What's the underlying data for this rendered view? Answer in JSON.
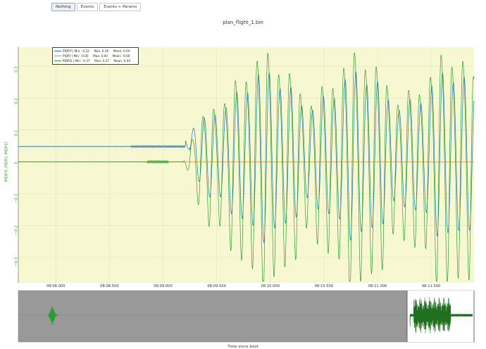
{
  "toolbar": {
    "buttons": [
      {
        "label": "Nothing",
        "active": true
      },
      {
        "label": "Events",
        "active": false
      },
      {
        "label": "Events + Params",
        "active": false
      }
    ]
  },
  "chart_data": {
    "type": "line",
    "title": "plan_flight_1.bin",
    "ylabel": "PIDP.P, PIDP.I, PIDP.D",
    "xlabel": "Time since boot",
    "background": "#f7f7d2",
    "navigator_background": "#999999",
    "x_ticks": [
      "08:08.000",
      "08:08.500",
      "08:09.000",
      "08:09.500",
      "08:10.000",
      "08:10.500",
      "08:11.000",
      "08:11.500"
    ],
    "xlim_seconds": [
      487.65,
      491.9
    ],
    "y_ticks": [
      {
        "value": 0.3,
        "label": "0.3"
      },
      {
        "value": 0.2,
        "label": "0.2"
      },
      {
        "value": 0.1,
        "label": "0.1"
      },
      {
        "value": 0,
        "label": "0"
      },
      {
        "value": -0.1,
        "label": "−0.1"
      },
      {
        "value": -0.2,
        "label": "−0.2"
      },
      {
        "value": -0.3,
        "label": "−0.3"
      }
    ],
    "ylim": [
      -0.38,
      0.36
    ],
    "legend_placement": "top-left",
    "series": [
      {
        "name": "PIDP.P",
        "color": "#1f77b4",
        "min": "-0.22",
        "max": "0.26",
        "mean": "0.04",
        "steady_value": 0.048,
        "oscillation_start_s": 489.25,
        "period_s": 0.101,
        "peak_amplitude": 0.26
      },
      {
        "name": "PIDP.I",
        "color": "#ff7f0e",
        "min": "-0.00",
        "max": "0.00",
        "mean": "-0.00",
        "steady_value": 0.0
      },
      {
        "name": "PIDP.D",
        "color": "#2ca02c",
        "min": "-0.37",
        "max": "0.37",
        "mean": "0.00",
        "steady_value": 0.0,
        "oscillation_start_s": 489.25,
        "period_s": 0.101,
        "peak_amplitude": 0.37
      }
    ],
    "legend_rows": [
      "PIDP.P | Min: -0.22     Max: 0.26     Mean: 0.04",
      "PIDP.I | Min: -0.00     Max: 0.00     Mean: -0.00",
      "PIDP.D | Min: -0.37     Max: 0.37     Mean: 0.00"
    ]
  }
}
